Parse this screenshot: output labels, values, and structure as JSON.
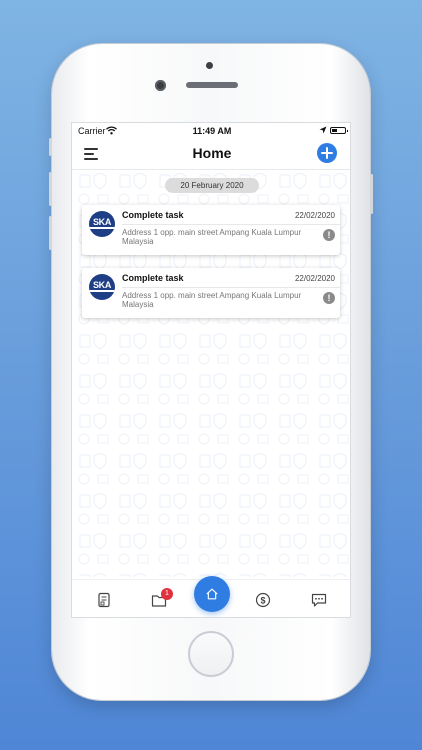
{
  "status_bar": {
    "carrier": "Carrier",
    "time": "11:49 AM"
  },
  "nav": {
    "title": "Home"
  },
  "date_chip": "20 February 2020",
  "tasks": [
    {
      "title": "Complete task",
      "date": "22/02/2020",
      "address": "Address 1 opp. main street Ampang Kuala Lumpur Malaysia",
      "logo_text": "SKA",
      "alert_glyph": "!"
    },
    {
      "title": "Complete task",
      "date": "22/02/2020",
      "address": "Address 1 opp. main street Ampang Kuala Lumpur Malaysia",
      "logo_text": "SKA",
      "alert_glyph": "!"
    }
  ],
  "tab_bar": {
    "folder_badge": "1",
    "items": [
      "document-icon",
      "folder-icon",
      "home-icon",
      "dollar-icon",
      "chat-icon"
    ]
  },
  "colors": {
    "accent": "#2f7de2",
    "badge": "#e0313f",
    "logo": "#1e3f86",
    "background": "#6a9fdc"
  }
}
